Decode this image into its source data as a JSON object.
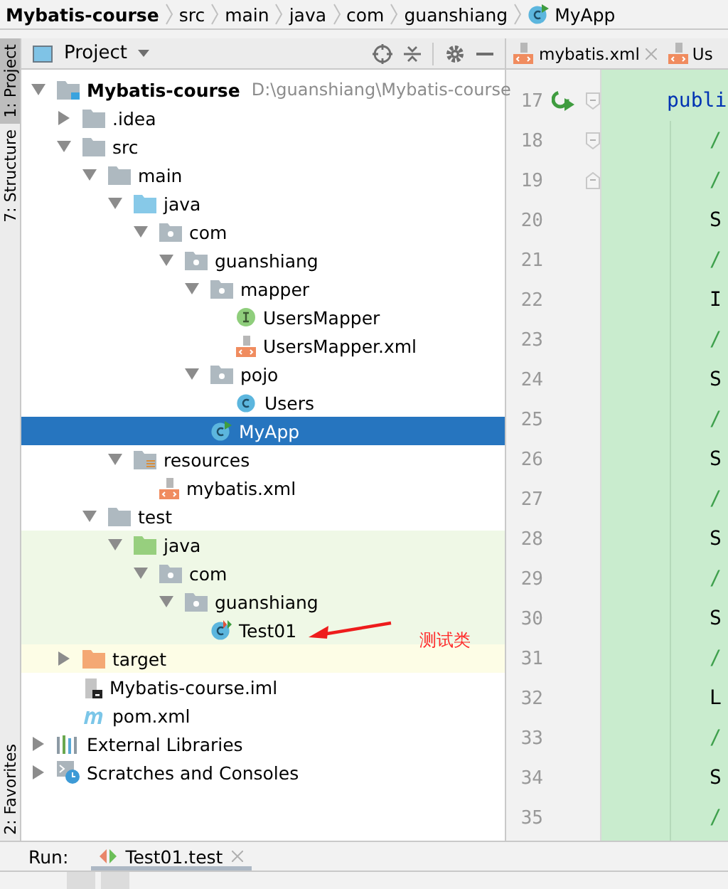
{
  "breadcrumb": [
    {
      "label": "Mybatis-course",
      "kind": "project"
    },
    {
      "label": "src",
      "kind": "folder"
    },
    {
      "label": "main",
      "kind": "folder"
    },
    {
      "label": "java",
      "kind": "folder"
    },
    {
      "label": "com",
      "kind": "folder"
    },
    {
      "label": "guanshiang",
      "kind": "folder"
    },
    {
      "label": "MyApp",
      "kind": "class"
    }
  ],
  "side_tabs": [
    {
      "label": "1: Project",
      "selected": true
    },
    {
      "label": "7: Structure",
      "selected": false
    }
  ],
  "side_tabs_bottom": [
    {
      "label": "2: Favorites",
      "selected": false
    }
  ],
  "project_panel": {
    "title": "Project",
    "tree": [
      {
        "label": "Mybatis-course",
        "path": "D:\\guanshiang\\Mybatis-course",
        "kind": "module",
        "expanded": true,
        "selected": false,
        "children": [
          {
            "label": ".idea",
            "kind": "folder",
            "expanded": false,
            "selected": false
          },
          {
            "label": "src",
            "kind": "folder",
            "expanded": true,
            "selected": false,
            "children": [
              {
                "label": "main",
                "kind": "folder",
                "expanded": true,
                "selected": false,
                "children": [
                  {
                    "label": "java",
                    "kind": "source",
                    "expanded": true,
                    "selected": false,
                    "children": [
                      {
                        "label": "com",
                        "kind": "package",
                        "expanded": true,
                        "selected": false,
                        "children": [
                          {
                            "label": "guanshiang",
                            "kind": "package",
                            "expanded": true,
                            "selected": false,
                            "children": [
                              {
                                "label": "mapper",
                                "kind": "package",
                                "expanded": true,
                                "selected": false,
                                "children": [
                                  {
                                    "label": "UsersMapper",
                                    "kind": "interface",
                                    "selected": false
                                  },
                                  {
                                    "label": "UsersMapper.xml",
                                    "kind": "xml",
                                    "selected": false
                                  }
                                ]
                              },
                              {
                                "label": "pojo",
                                "kind": "package",
                                "expanded": true,
                                "selected": false,
                                "children": [
                                  {
                                    "label": "Users",
                                    "kind": "class",
                                    "selected": false
                                  }
                                ]
                              },
                              {
                                "label": "MyApp",
                                "kind": "runnable",
                                "selected": true
                              }
                            ]
                          }
                        ]
                      }
                    ]
                  },
                  {
                    "label": "resources",
                    "kind": "resources",
                    "expanded": true,
                    "selected": false,
                    "children": [
                      {
                        "label": "mybatis.xml",
                        "kind": "xml",
                        "selected": false
                      }
                    ]
                  }
                ]
              },
              {
                "label": "test",
                "kind": "folder",
                "expanded": true,
                "selected": false,
                "children": [
                  {
                    "label": "java",
                    "kind": "test",
                    "expanded": true,
                    "selected": false,
                    "children": [
                      {
                        "label": "com",
                        "kind": "package",
                        "expanded": true,
                        "selected": false,
                        "children": [
                          {
                            "label": "guanshiang",
                            "kind": "package",
                            "expanded": true,
                            "selected": false,
                            "children": [
                              {
                                "label": "Test01",
                                "kind": "testclass",
                                "selected": false
                              }
                            ]
                          }
                        ]
                      }
                    ]
                  }
                ]
              }
            ]
          },
          {
            "label": "target",
            "kind": "excluded",
            "expanded": false,
            "selected": false
          },
          {
            "label": "Mybatis-course.iml",
            "kind": "iml",
            "selected": false
          },
          {
            "label": "pom.xml",
            "kind": "maven",
            "selected": false
          }
        ]
      },
      {
        "label": "External Libraries",
        "kind": "libraries",
        "expanded": false,
        "selected": false
      },
      {
        "label": "Scratches and Consoles",
        "kind": "scratches",
        "expanded": false,
        "selected": false
      }
    ],
    "annotation": "测试类"
  },
  "editor": {
    "tabs": [
      {
        "label": "mybatis.xml",
        "selected": false
      },
      {
        "label": "Us",
        "selected": false
      }
    ],
    "lines": [
      {
        "number": "17",
        "text": "publi",
        "kind": "keyword",
        "runnable": true,
        "fold_start": true,
        "fold_end": false
      },
      {
        "number": "18",
        "text": "/",
        "kind": "comment",
        "runnable": false,
        "fold_start": true,
        "fold_end": false
      },
      {
        "number": "19",
        "text": "/",
        "kind": "comment",
        "runnable": false,
        "fold_start": false,
        "fold_end": true
      },
      {
        "number": "20",
        "text": "S",
        "kind": "code"
      },
      {
        "number": "21",
        "text": "/",
        "kind": "comment"
      },
      {
        "number": "22",
        "text": "I",
        "kind": "code"
      },
      {
        "number": "23",
        "text": "/",
        "kind": "comment"
      },
      {
        "number": "24",
        "text": "S",
        "kind": "code"
      },
      {
        "number": "25",
        "text": "/",
        "kind": "comment"
      },
      {
        "number": "26",
        "text": "S",
        "kind": "code"
      },
      {
        "number": "27",
        "text": "/",
        "kind": "comment"
      },
      {
        "number": "28",
        "text": "S",
        "kind": "code"
      },
      {
        "number": "29",
        "text": "/",
        "kind": "comment"
      },
      {
        "number": "30",
        "text": "S",
        "kind": "code"
      },
      {
        "number": "31",
        "text": "/",
        "kind": "comment"
      },
      {
        "number": "32",
        "text": "L",
        "kind": "code"
      },
      {
        "number": "33",
        "text": "/",
        "kind": "comment"
      },
      {
        "number": "34",
        "text": "S",
        "kind": "code"
      },
      {
        "number": "35",
        "text": "/",
        "kind": "comment"
      }
    ]
  },
  "run_bar": {
    "label": "Run:",
    "tabs": [
      {
        "label": "Test01.test",
        "selected": true
      }
    ]
  }
}
